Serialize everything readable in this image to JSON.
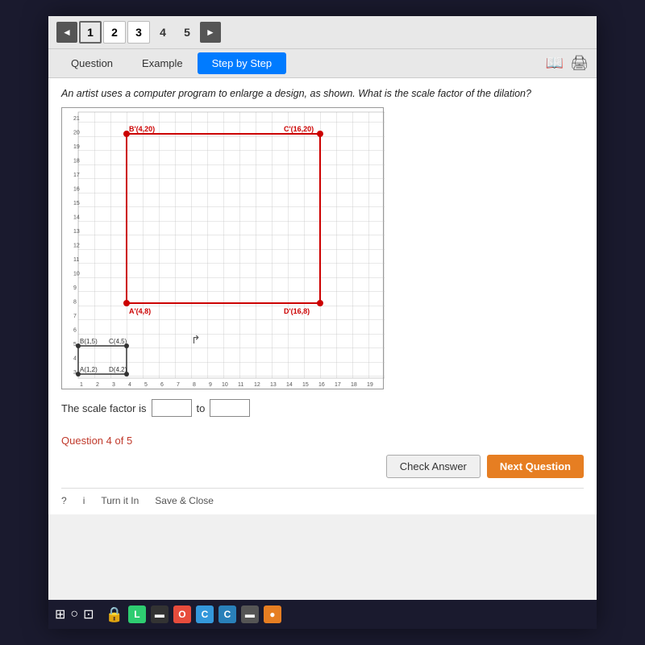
{
  "nav": {
    "steps": [
      "1",
      "2",
      "3",
      "4",
      "5"
    ],
    "left_arrow": "◄",
    "right_arrow": "►"
  },
  "tabs": {
    "items": [
      "Question",
      "Example",
      "Step by Step"
    ],
    "active": "Step by Step"
  },
  "question": {
    "text": "An artist uses a computer program to enlarge a design, as shown. What is the scale factor of the dilation?"
  },
  "graph": {
    "large_points": {
      "B_prime": "B'(4,20)",
      "C_prime": "C'(16,20)",
      "A_prime": "A'(4,8)",
      "D_prime": "D'(16,8)"
    },
    "small_points": {
      "B": "B(1,5)",
      "C": "C(4,5)",
      "A": "A(1,2)",
      "D": "D(4,2)"
    }
  },
  "scale_factor": {
    "label": "The scale factor is",
    "input_value": "",
    "to_label": "to",
    "input2_value": ""
  },
  "footer": {
    "question_counter": "Question 4 of 5",
    "check_answer_label": "Check Answer",
    "next_question_label": "Next Question",
    "turn_it_in_label": "Turn it In",
    "save_close_label": "Save & Close"
  },
  "taskbar": {
    "icons": [
      "⊞",
      "○",
      "⊡",
      "🔒",
      "L",
      "▬",
      "O",
      "C",
      "C",
      "▬",
      "●"
    ]
  }
}
